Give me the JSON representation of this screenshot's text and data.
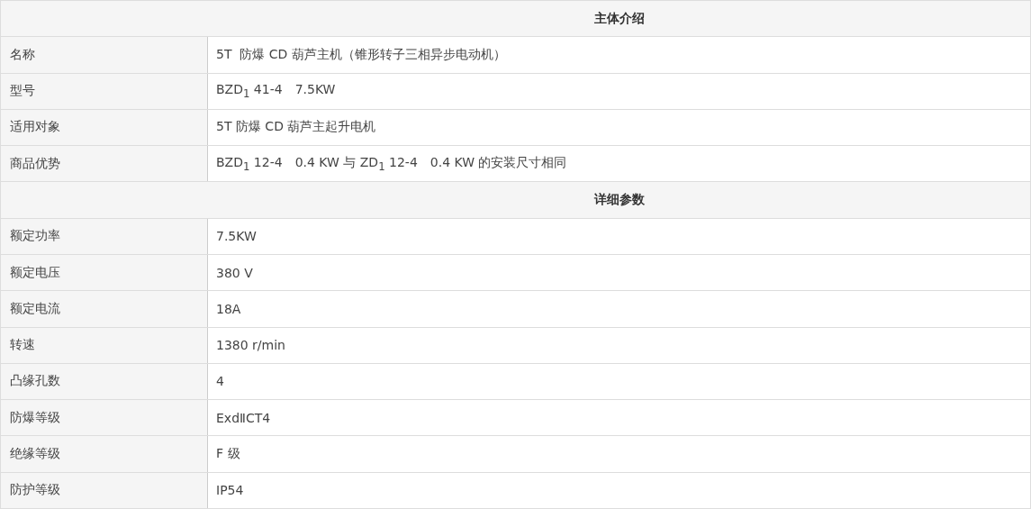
{
  "sections": [
    {
      "title": "主体介绍",
      "rows": [
        {
          "label": "名称",
          "value": "5T  防爆 CD 葫芦主机（锥形转子三相异步电动机）"
        },
        {
          "label": "型号",
          "value": "BZD$_{1}$ 41-4　7.5KW"
        },
        {
          "label": "适用对象",
          "value": "5T 防爆 CD 葫芦主起升电机"
        },
        {
          "label": "商品优势",
          "value": "BZD$_{1}$ 12-4　0.4 KW 与 ZD$_{1}$ 12-4　0.4 KW 的安装尺寸相同"
        }
      ]
    },
    {
      "title": "详细参数",
      "rows": [
        {
          "label": "额定功率",
          "value": "7.5KW"
        },
        {
          "label": "额定电压",
          "value": "380 V"
        },
        {
          "label": "额定电流",
          "value": "18A"
        },
        {
          "label": "转速",
          "value": "1380 r/min"
        },
        {
          "label": "凸缘孔数",
          "value": "4"
        },
        {
          "label": "防爆等级",
          "value": "ExdⅡCT4"
        },
        {
          "label": "绝缘等级",
          "value": "F 级"
        },
        {
          "label": "防护等级",
          "value": "IP54"
        }
      ]
    }
  ]
}
